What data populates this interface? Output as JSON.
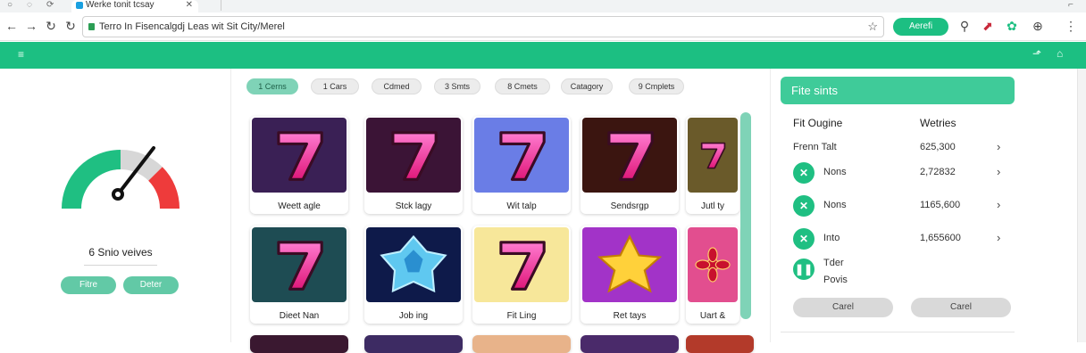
{
  "browser": {
    "tab_title": "Werke tonit tcsay",
    "address": "Terro In Fisencalgdj Leas wit Sit City/Merel",
    "extension_button": "Aerefi"
  },
  "left_panel": {
    "gauge_caption": "6 Snio veives",
    "btn_primary": "Fitre",
    "btn_secondary": "Deter"
  },
  "filters": [
    {
      "label": "1 Cerns",
      "active": true
    },
    {
      "label": "1 Cars",
      "active": false
    },
    {
      "label": "Cdmed",
      "active": false
    },
    {
      "label": "3 Smts",
      "active": false
    },
    {
      "label": "8 Cmets",
      "active": false
    },
    {
      "label": "Catagory",
      "active": false
    },
    {
      "label": "9 Cmplets",
      "active": false
    }
  ],
  "games": [
    {
      "label": "Weett agle",
      "art": "seven",
      "bg": "#3a2055"
    },
    {
      "label": "Stck lagy",
      "art": "seven",
      "bg": "#3b1436"
    },
    {
      "label": "Wit talp",
      "art": "seven",
      "bg": "#6a7de6"
    },
    {
      "label": "Sendsrgp",
      "art": "seven",
      "bg": "#3b1510"
    },
    {
      "label": "Jutl ty",
      "art": "seven",
      "bg": "#6a5a2a"
    },
    {
      "label": "Dieet Nan",
      "art": "seven",
      "bg": "#1e4c53"
    },
    {
      "label": "Job ing",
      "art": "gem",
      "bg": "#0e1a4a"
    },
    {
      "label": "Fit Ling",
      "art": "seven",
      "bg": "#f7e79a"
    },
    {
      "label": "Ret tays",
      "art": "star",
      "bg": "#a233c8"
    },
    {
      "label": "Uart &",
      "art": "flower",
      "bg": "#e24e8f"
    }
  ],
  "right_panel": {
    "title": "Fite sints",
    "col_name": "Fit Ougine",
    "col_value": "Wetries",
    "rows": [
      {
        "name": "Frenn  Talt",
        "value": "625,300",
        "icon": "",
        "chev": "›"
      },
      {
        "name": "Nons",
        "value": "2,72832",
        "icon": "✕",
        "chev": "›"
      },
      {
        "name": "Nons",
        "value": "1165,600",
        "icon": "✕",
        "chev": "›"
      },
      {
        "name": "Into",
        "value": "1,655600",
        "icon": "✕",
        "chev": "›"
      }
    ],
    "extra_name_1": "Tder",
    "extra_name_2": "Povis",
    "btn_left": "Carel",
    "btn_right": "Carel"
  }
}
